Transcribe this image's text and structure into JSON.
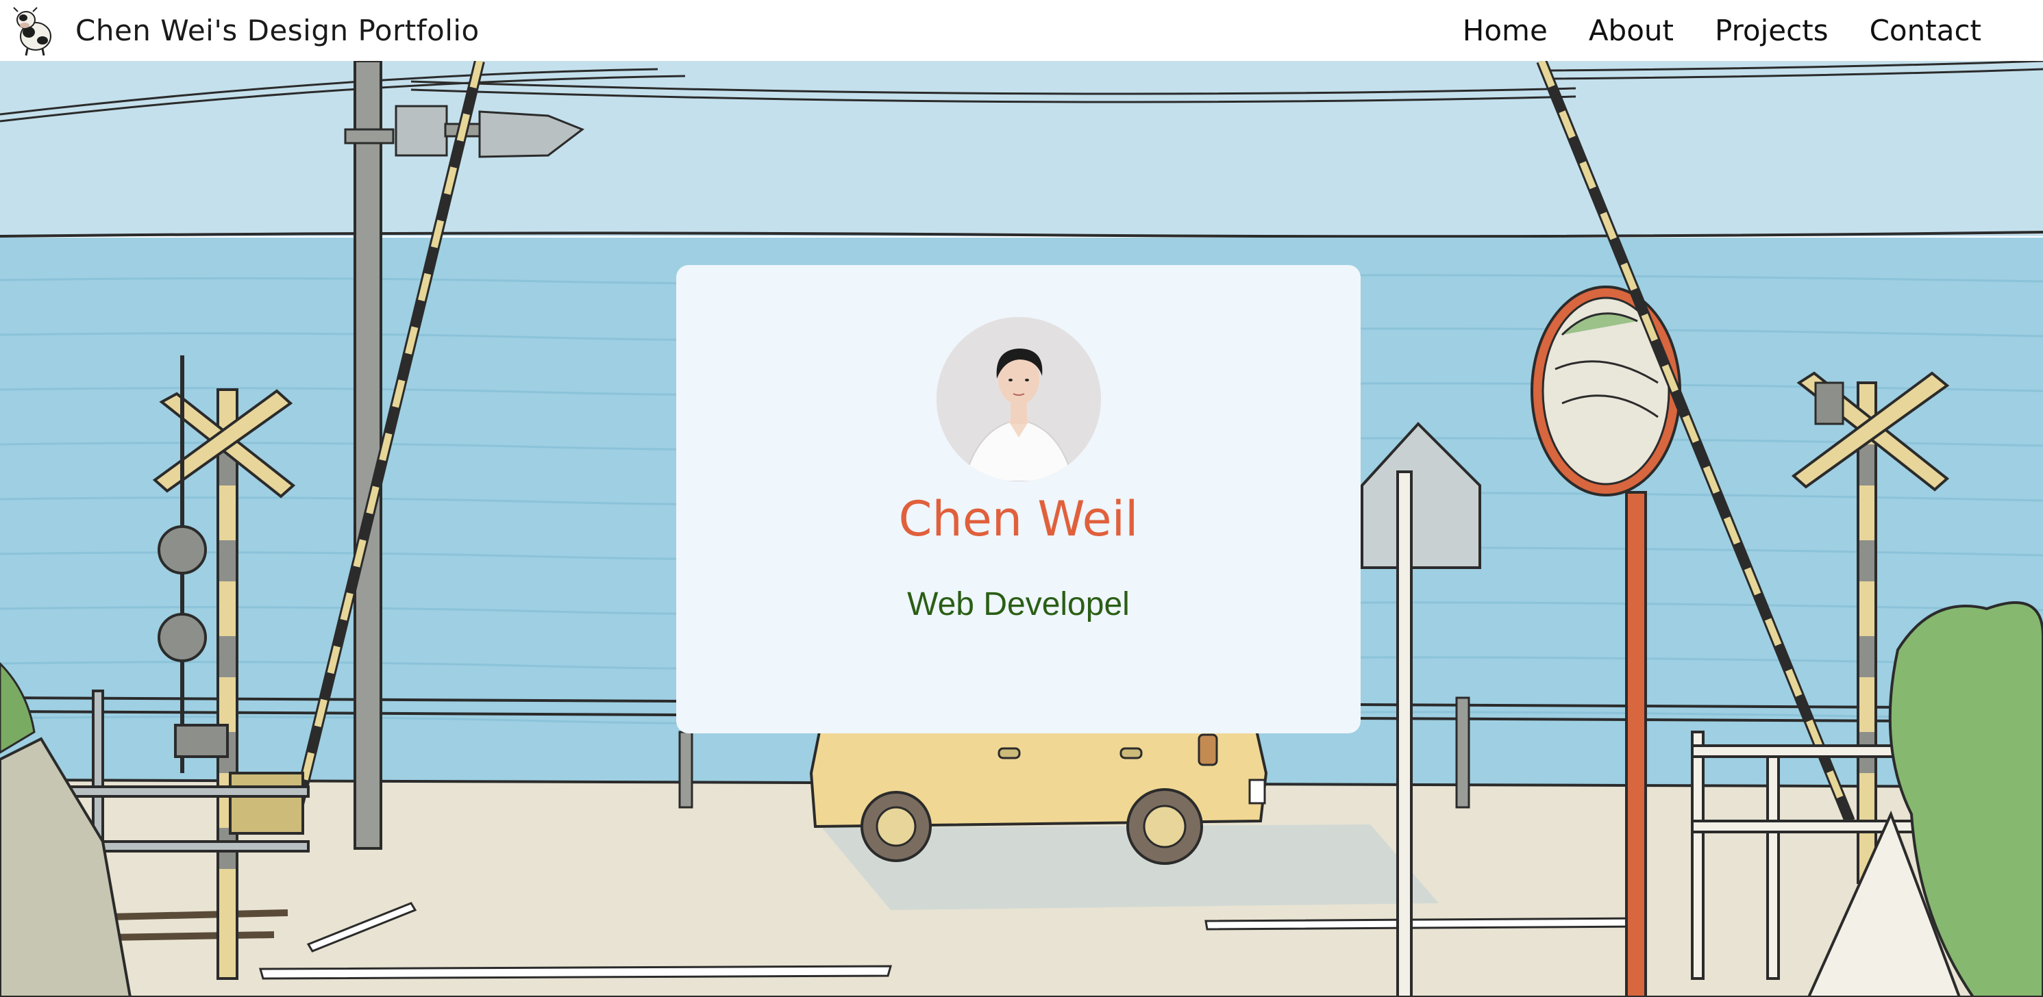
{
  "header": {
    "brand_title": "Chen Wei's Design Portfolio",
    "logo_icon": "cow-logo-icon"
  },
  "nav": {
    "items": [
      {
        "label": "Home"
      },
      {
        "label": "About"
      },
      {
        "label": "Projects"
      },
      {
        "label": "Contact"
      }
    ]
  },
  "profile": {
    "name": "Chen Weil",
    "role": "Web Developel",
    "avatar_icon": "profile-photo"
  },
  "colors": {
    "name": "#e0603c",
    "role": "#2a5e15",
    "card_bg": "#eff6fc",
    "sky": "#c4e0ec",
    "sea": "#9ecfe2",
    "ground": "#e8e3d2"
  }
}
